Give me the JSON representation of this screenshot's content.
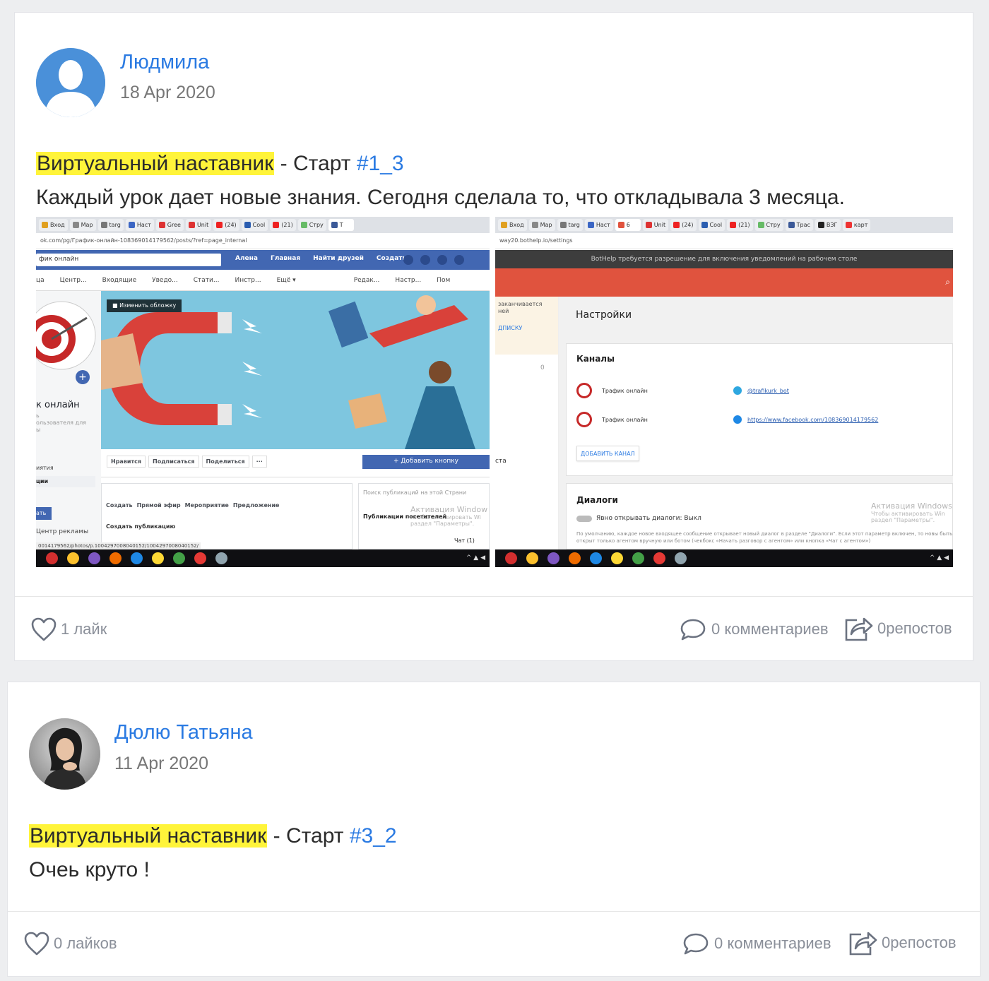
{
  "posts": [
    {
      "author": "Людмила",
      "date": "18 Apr 2020",
      "highlight": "Виртуальный наставник",
      "sep": " - Старт ",
      "hashtag": "#1_3",
      "text": "Каждый урок дает новые знания. Сегодня сделала то, что откладывала 3 месяца.",
      "likes": "1 лайк",
      "comments": "0 комментариев",
      "reposts": "0репостов",
      "attachment": {
        "left": {
          "tabs": [
            "Вход",
            "Map",
            "targ",
            "Наст",
            "Gree",
            "Unit",
            "(24)",
            "Cool",
            "(21)",
            "Стру",
            "T"
          ],
          "url": "ok.com/pg/График-онлайн-108369014179562/posts/?ref=page_internal",
          "search": "фик онлайн",
          "nav": [
            "Алена",
            "Главная",
            "Найти друзей",
            "Создать"
          ],
          "menu": [
            "ца",
            "Центр...",
            "Входящие",
            "Уведо...",
            "Стати...",
            "Инстр...",
            "Ещё ▾",
            "Редак...",
            "Настр...",
            "Пом"
          ],
          "cover_button": "Изменить обложку",
          "page_name": "к онлайн",
          "page_sub": "ь\nользователя для\nы",
          "side_items": [
            "иятия",
            "ции"
          ],
          "ads_btn": "ать",
          "ads_center": "Центр рекламы",
          "actions": [
            "Нравится",
            "Подписаться",
            "Поделиться",
            "···"
          ],
          "add_button": "+ Добавить кнопку",
          "create": [
            "Создать",
            "Прямой эфир",
            "Мероприятие",
            "Предложение"
          ],
          "create_post": "Создать публикацию",
          "search_posts": "Поиск публикаций на этой Страни",
          "visitors": "Публикации посетителей",
          "chat": "Чат (1)",
          "watermark": "Активация Window",
          "watermark_sub": "Чтобы активировать Wi\nраздел \"Параметры\".",
          "status_url": "0014179562/photos/p.1004297008040152/1004297008040152/"
        },
        "right": {
          "tabs": [
            "Вход",
            "Map",
            "targ",
            "Наст",
            "6",
            "Unit",
            "(24)",
            "Cool",
            "(21)",
            "Стру",
            "Трас",
            "ВЗГ",
            "карт",
            "карт"
          ],
          "url": "way20.bothelp.io/settings",
          "banner": "BotHelp требуется разрешение для включения уведомлений на рабочем столе",
          "side_note": "заканчивается\nней",
          "side_link": "ДПИСКУ",
          "side_zero": "0",
          "side_sta": "ста",
          "settings_title": "Настройки",
          "channels_title": "Каналы",
          "channels": [
            {
              "name": "Трафик онлайн",
              "link": "@trafikurk_bot"
            },
            {
              "name": "Трафик онлайн",
              "link": "https://www.facebook.com/108369014179562"
            }
          ],
          "add_channel": "ДОБАВИТЬ КАНАЛ",
          "dialogs_title": "Диалоги",
          "dialogs_toggle": "Явно открывать диалоги: Выкл",
          "dialogs_desc": "По умолчанию, каждое новое входящее сообщение открывает новый диалог в разделе \"Диалоги\". Если этот параметр включен, то новы быть открыт только агентом вручную или ботом (чекбокс «Начать разговор с агентом» или кнопка «Чат с агентом»)",
          "watermark": "Активация Windows",
          "watermark_sub": "Чтобы активировать Win\nраздел \"Параметры\"."
        }
      }
    },
    {
      "author": "Дюлю Татьяна",
      "date": "11 Apr 2020",
      "highlight": "Виртуальный наставник",
      "sep": " - Старт ",
      "hashtag": "#3_2",
      "text": "Очеь круто !",
      "likes": "0 лайков",
      "comments": "0 комментариев",
      "reposts": "0репостов"
    }
  ],
  "colors": {
    "link": "#2a7ae2",
    "highlight": "#fff43a",
    "muted": "#8a8f99",
    "fb_blue": "#4267b2",
    "bothelp_red": "#e0533e"
  }
}
